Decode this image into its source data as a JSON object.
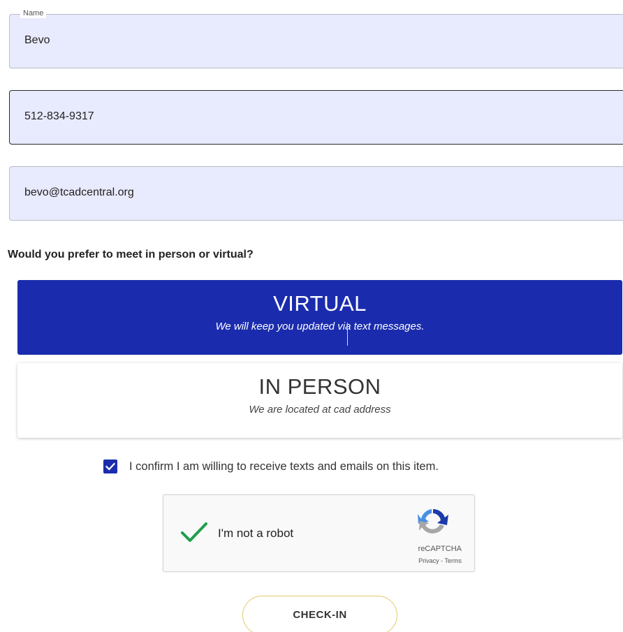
{
  "form": {
    "name": {
      "label": "Name",
      "value": "Bevo"
    },
    "phone": {
      "value": "512-834-9317"
    },
    "email": {
      "value": "bevo@tcadcentral.org"
    }
  },
  "meeting": {
    "question": "Would you prefer to meet in person or virtual?",
    "options": [
      {
        "title": "VIRTUAL",
        "subtitle": "We will keep you updated via text messages.",
        "selected": true
      },
      {
        "title": "IN PERSON",
        "subtitle": "We are located at cad address",
        "selected": false
      }
    ]
  },
  "consent": {
    "checked": true,
    "label": "I confirm I am willing to receive texts and emails on this item."
  },
  "captcha": {
    "label": "I'm not a robot",
    "brand": "reCAPTCHA",
    "privacy": "Privacy",
    "separator": " - ",
    "terms": "Terms",
    "verified": true
  },
  "submit": {
    "label": "CHECK-IN"
  },
  "colors": {
    "accent": "#1a2cad",
    "field_bg": "#e8eafd",
    "button_border": "#e7c96a",
    "check_green": "#1e9e4a"
  }
}
